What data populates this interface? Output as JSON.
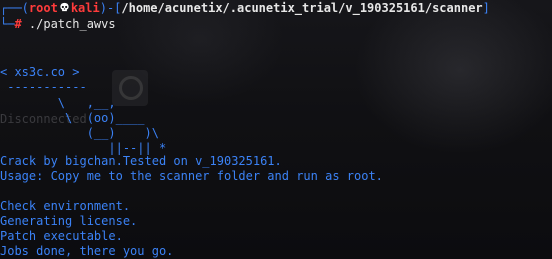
{
  "prompt": {
    "corner_top": "┌──(",
    "user": "root",
    "host": "kali",
    "path_prefix": ")-[",
    "path": "/home/acunetix/.acunetix_trial/v_190325161/scanner",
    "path_suffix": "]",
    "corner_bottom": "└─",
    "symbol": "#",
    "command": " ./patch_awvs"
  },
  "banner": {
    "line1": "< xs3c.co >",
    "line2": " -----------",
    "line3": "        \\   ,__,",
    "line4": "         \\  (oo)____",
    "line5": "            (__)    )\\",
    "line6": "               ||--|| *",
    "background_watermark": "Disconnected"
  },
  "messages": {
    "crack": "Crack by bigchan.Tested on v_190325161.",
    "usage": "Usage: Copy me to the scanner folder and run as root."
  },
  "log": [
    "Check environment.",
    "Generating license.",
    "Patch executable.",
    "Jobs done, there you go."
  ],
  "colors": {
    "blue": "#3b82f6",
    "red": "#ff3b3b",
    "white": "#e7e7e7",
    "background": "#0f0f12"
  },
  "icons": {
    "prompt_glyph": "skull-icon"
  }
}
